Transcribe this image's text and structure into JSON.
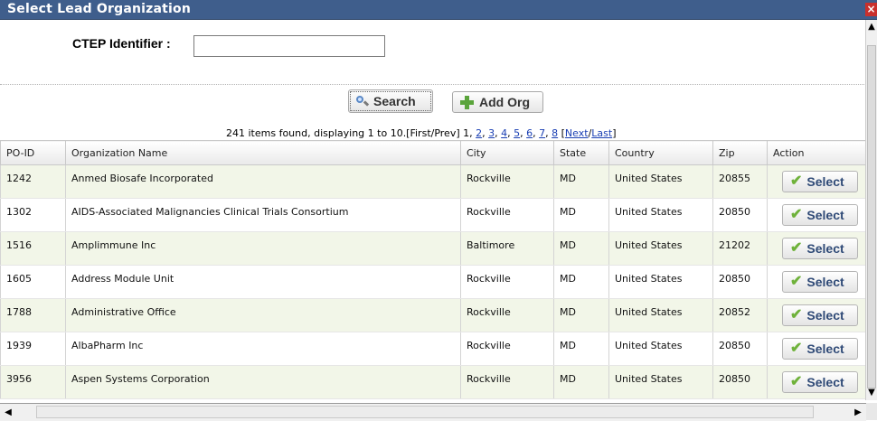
{
  "dialog": {
    "title": "Select Lead Organization",
    "close_glyph": "×"
  },
  "search": {
    "ctep_label": "CTEP Identifier :",
    "ctep_value": "",
    "search_button": "Search",
    "add_org_button": "Add Org"
  },
  "pagination": {
    "summary": "241 items found, displaying 1 to 10.[First/Prev] 1,",
    "pages": [
      "2",
      "3",
      "4",
      "5",
      "6",
      "7",
      "8"
    ],
    "next_label": "Next",
    "last_label": "Last"
  },
  "table": {
    "headers": [
      "PO-ID",
      "Organization Name",
      "City",
      "State",
      "Country",
      "Zip",
      "Action"
    ],
    "rows": [
      {
        "po_id": "1242",
        "name": "Anmed Biosafe Incorporated",
        "city": "Rockville",
        "state": "MD",
        "country": "United States",
        "zip": "20855",
        "action": "Select"
      },
      {
        "po_id": "1302",
        "name": "AIDS-Associated Malignancies Clinical Trials Consortium",
        "city": "Rockville",
        "state": "MD",
        "country": "United States",
        "zip": "20850",
        "action": "Select"
      },
      {
        "po_id": "1516",
        "name": "Amplimmune Inc",
        "city": "Baltimore",
        "state": "MD",
        "country": "United States",
        "zip": "21202",
        "action": "Select"
      },
      {
        "po_id": "1605",
        "name": "Address Module Unit",
        "city": "Rockville",
        "state": "MD",
        "country": "United States",
        "zip": "20850",
        "action": "Select"
      },
      {
        "po_id": "1788",
        "name": "Administrative Office",
        "city": "Rockville",
        "state": "MD",
        "country": "United States",
        "zip": "20852",
        "action": "Select"
      },
      {
        "po_id": "1939",
        "name": "AlbaPharm Inc",
        "city": "Rockville",
        "state": "MD",
        "country": "United States",
        "zip": "20850",
        "action": "Select"
      },
      {
        "po_id": "3956",
        "name": "Aspen Systems Corporation",
        "city": "Rockville",
        "state": "MD",
        "country": "United States",
        "zip": "20850",
        "action": "Select"
      }
    ]
  },
  "colors": {
    "titlebar": "#3f5e8c",
    "row_alt": "#f2f6e8",
    "link": "#1a3fb3",
    "check": "#6fb23b"
  },
  "icons": {
    "search": "magnifier-icon",
    "add": "plus-icon",
    "select": "checkmark-icon"
  }
}
